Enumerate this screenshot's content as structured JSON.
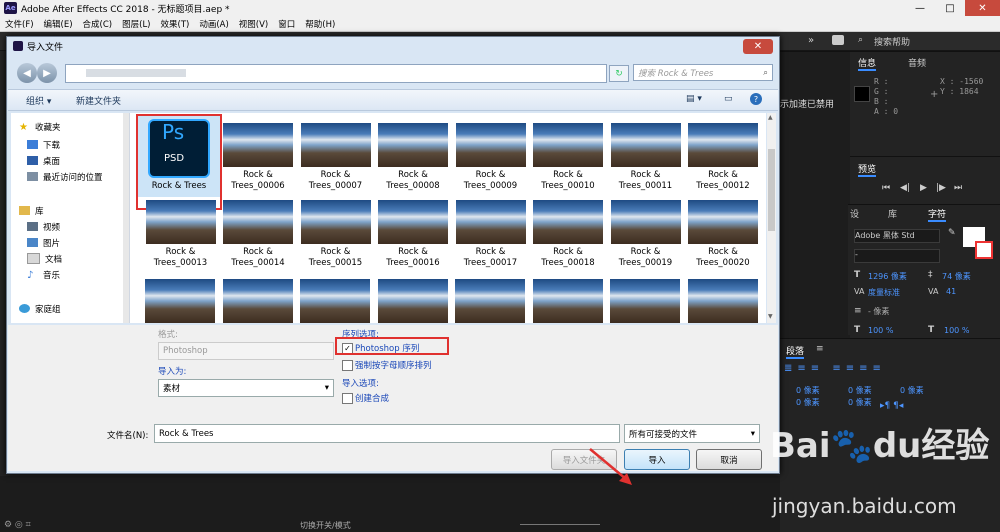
{
  "ae": {
    "title": "Adobe After Effects CC 2018 - 无标题项目.aep *",
    "logo": "Ae",
    "window_controls": [
      "—",
      "□",
      "✕"
    ],
    "menu": [
      "文件(F)",
      "编辑(E)",
      "合成(C)",
      "图层(L)",
      "效果(T)",
      "动画(A)",
      "视图(V)",
      "窗口",
      "帮助(H)"
    ],
    "search_help": "搜索帮助",
    "accel_disabled": "示加速已禁用",
    "info_panel": {
      "tabs": [
        "信息",
        "音频"
      ],
      "r": "R :",
      "g": "G :",
      "b": "B :",
      "a": "A :  0",
      "x": "X : -1560",
      "y": "Y : 1864"
    },
    "preview_panel": {
      "tab": "预览",
      "controls": [
        "⏮",
        "◀|",
        "▶",
        "|▶",
        "⏭"
      ]
    },
    "char_panel": {
      "tabs": [
        "设",
        "库",
        "字符"
      ],
      "font": "Adobe 黑体 Std",
      "style": "-",
      "size": "1296 像素",
      "leading": "74 像素",
      "kerning": "度量标准",
      "tracking": "41",
      "stroke": "- 像素",
      "vscale": "100 %",
      "hscale": "100 %"
    },
    "para_panel": {
      "tab": "段落",
      "indents": [
        "0 像素",
        "0 像素",
        "0 像素",
        "0 像素",
        "0 像素"
      ]
    },
    "bottom_toggle": "切换开关/模式"
  },
  "dialog": {
    "title": "导入文件",
    "close": "✕",
    "search_placeholder": "搜索 Rock & Trees",
    "organize": "组织 ▾",
    "new_folder": "新建文件夹",
    "nav": {
      "favorites": "收藏夹",
      "download": "下载",
      "desktop": "桌面",
      "recent": "最近访问的位置",
      "libraries": "库",
      "videos": "视频",
      "pictures": "图片",
      "documents": "文档",
      "music": "音乐",
      "homegroup": "家庭组"
    },
    "psd_icon": {
      "ps": "Ps",
      "psd": "PSD"
    },
    "files": [
      [
        "Rock & Trees",
        ""
      ],
      [
        "Rock &",
        "Trees_00006"
      ],
      [
        "Rock &",
        "Trees_00007"
      ],
      [
        "Rock &",
        "Trees_00008"
      ],
      [
        "Rock &",
        "Trees_00009"
      ],
      [
        "Rock &",
        "Trees_00010"
      ],
      [
        "Rock &",
        "Trees_00011"
      ],
      [
        "Rock &",
        "Trees_00012"
      ],
      [
        "Rock &",
        "Trees_00013"
      ],
      [
        "Rock &",
        "Trees_00014"
      ],
      [
        "Rock &",
        "Trees_00015"
      ],
      [
        "Rock &",
        "Trees_00016"
      ],
      [
        "Rock &",
        "Trees_00017"
      ],
      [
        "Rock &",
        "Trees_00018"
      ],
      [
        "Rock &",
        "Trees_00019"
      ],
      [
        "Rock &",
        "Trees_00020"
      ]
    ],
    "format_label": "格式:",
    "format_value": "Photoshop",
    "import_as_label": "导入为:",
    "import_as_value": "素材",
    "sequence_label": "序列选项:",
    "photoshop_sequence": "Photoshop 序列",
    "force_alpha": "强制按字母顺序排列",
    "import_options_label": "导入选项:",
    "create_comp": "创建合成",
    "filename_label": "文件名(N):",
    "filename_value": "Rock & Trees",
    "filetype_value": "所有可接受的文件",
    "import_folder": "导入文件夹",
    "import": "导入",
    "cancel": "取消"
  },
  "watermark": {
    "logo": "Bai🐾du经验",
    "url": "jingyan.baidu.com"
  },
  "colors": {
    "accent": "#3a8cff",
    "highlight": "#e0312f",
    "ps_blue": "#31a8ff",
    "ps_bg": "#001e36"
  }
}
